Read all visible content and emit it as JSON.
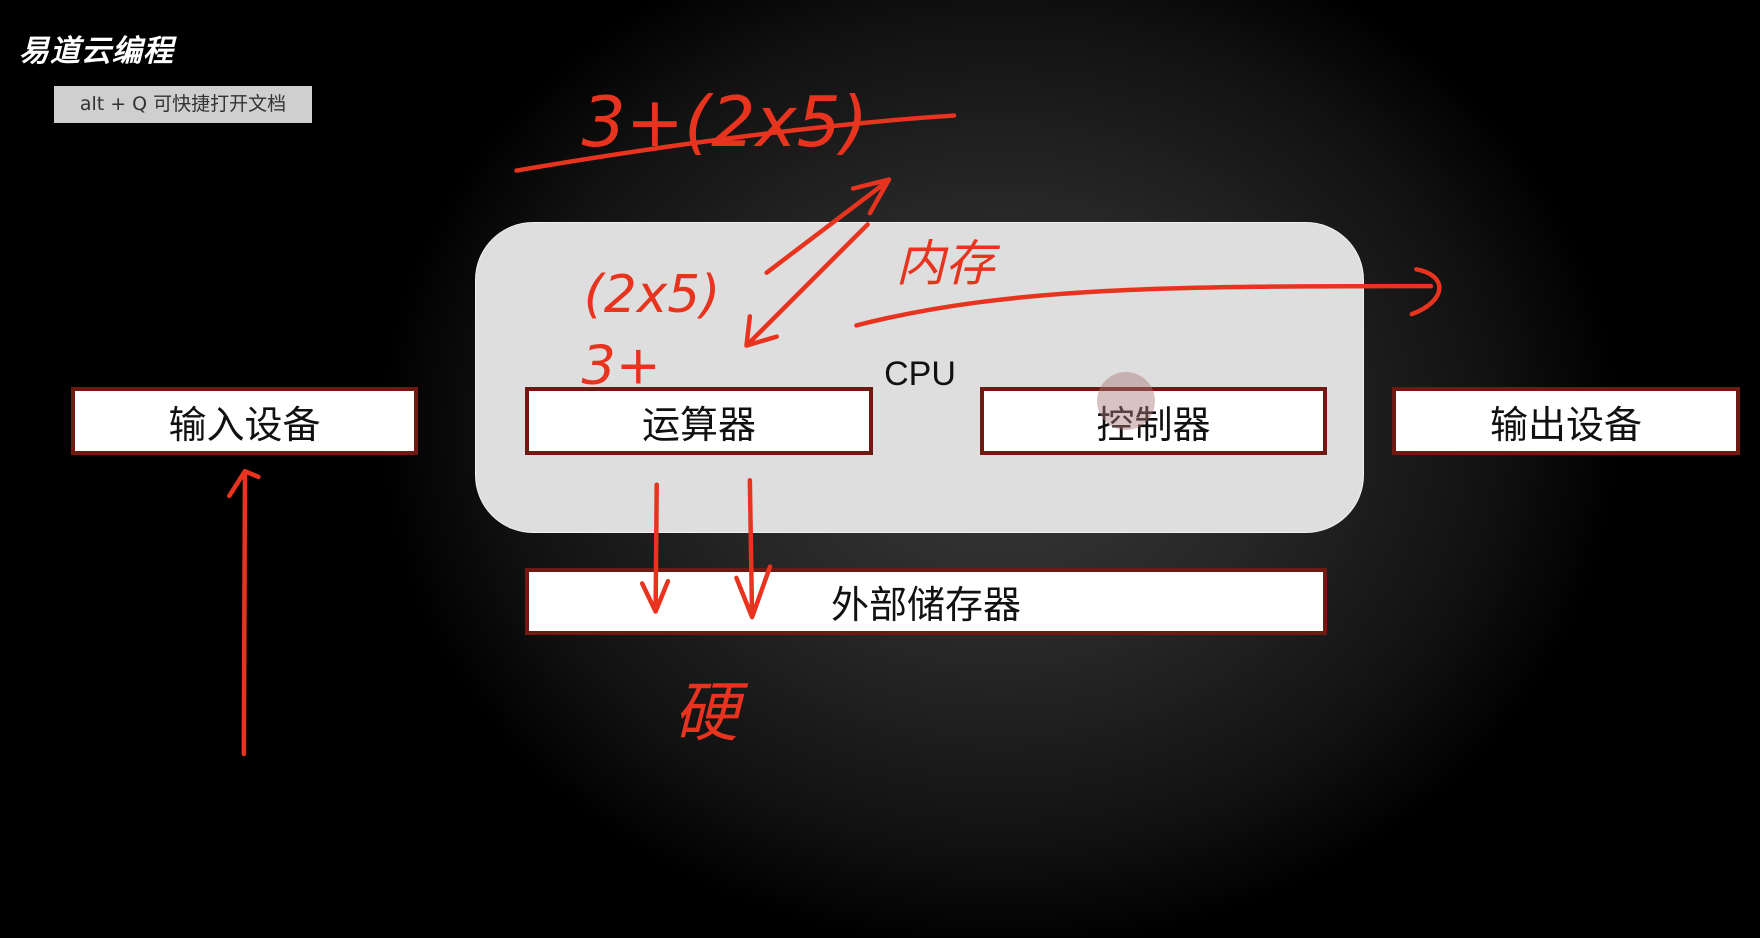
{
  "logo": "易道云编程",
  "tooltip": "alt + Q 可快捷打开文档",
  "diagram": {
    "cpu_label": "CPU",
    "input_device": "输入设备",
    "alu": "运算器",
    "controller": "控制器",
    "output_device": "输出设备",
    "external_storage": "外部储存器"
  },
  "annotations": {
    "expression": "3+(2x5)",
    "sub_expression": "(2x5)",
    "partial": "3+",
    "memory": "内存",
    "hard": "硬",
    "ink_color": "#e8341f"
  },
  "colors": {
    "box_border": "#6e1a12",
    "cpu_bg": "#dedede"
  }
}
